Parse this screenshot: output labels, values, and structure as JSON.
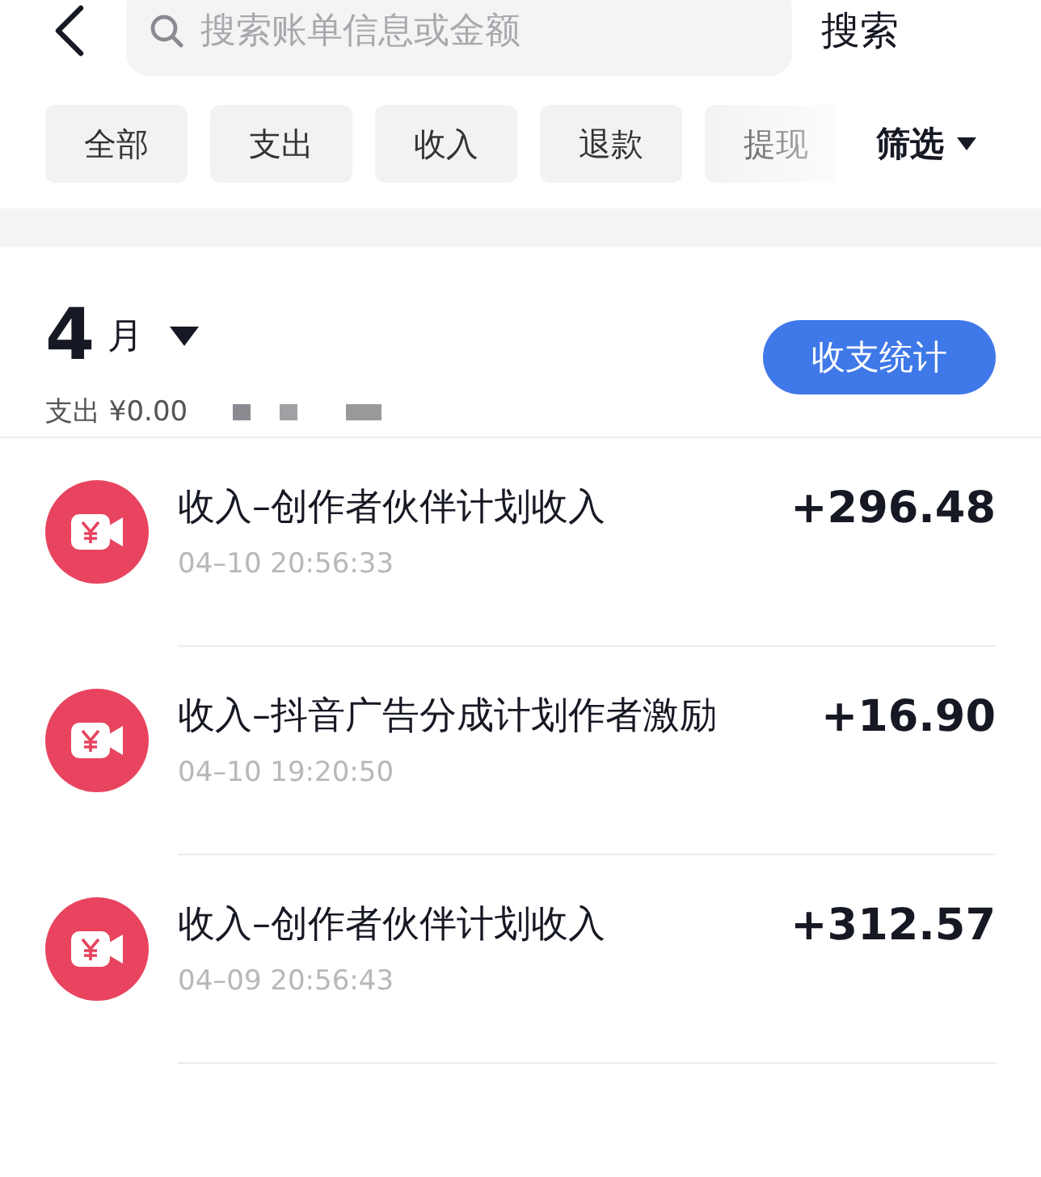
{
  "search": {
    "placeholder": "搜索账单信息或金额",
    "button": "搜索"
  },
  "filters": [
    {
      "label": "全部"
    },
    {
      "label": "支出"
    },
    {
      "label": "收入"
    },
    {
      "label": "退款"
    },
    {
      "label": "提现"
    }
  ],
  "filter_menu": "筛选",
  "month": {
    "number": "4",
    "unit": "月",
    "summary": "支出 ¥0.00",
    "stats_button": "收支统计"
  },
  "transactions": [
    {
      "title": "收入–创作者伙伴计划收入",
      "time": "04–10 20:56:33",
      "amount": "+296.48"
    },
    {
      "title": "收入–抖音广告分成计划作者激励",
      "time": "04–10 19:20:50",
      "amount": "+16.90"
    },
    {
      "title": "收入–创作者伙伴计划收入",
      "time": "04–09 20:56:43",
      "amount": "+312.57"
    }
  ]
}
